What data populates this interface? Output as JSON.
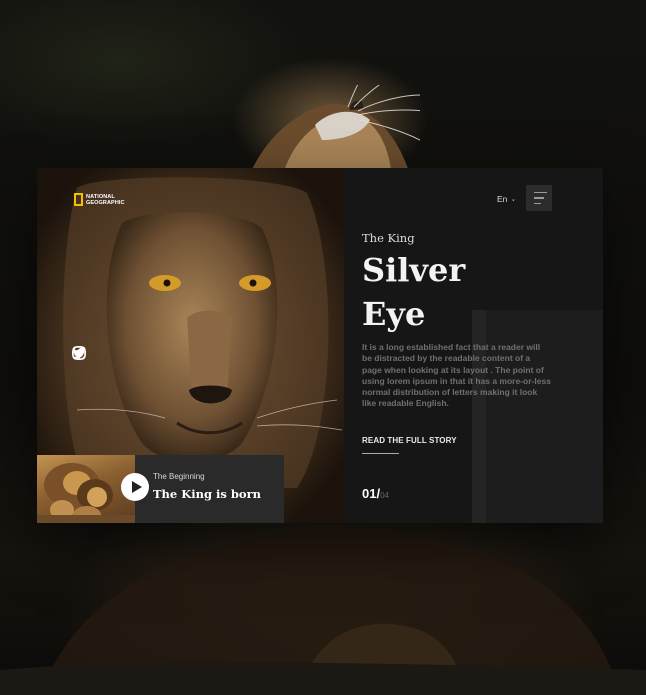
{
  "brand": {
    "logo_line1": "NATIONAL",
    "logo_line2": "GEOGRAPHIC",
    "accent": "#f2c200"
  },
  "header": {
    "language": "En",
    "menu_icon": "menu-icon"
  },
  "hero": {
    "eyebrow": "The King",
    "title_line1": "Silver",
    "title_line2": "Eye",
    "description": "It is a long established fact that a reader will be distracted by the readable content of a page when looking at its layout . The point of using lorem ipsum in that it has a more-or-less normal distribution of letters making it look like readable English.",
    "cta": "READ THE FULL STORY"
  },
  "pagination": {
    "current": "01/",
    "total": "04"
  },
  "social": [
    "facebook-icon",
    "instagram-icon",
    "twitter-icon"
  ],
  "story": {
    "subtitle": "The Beginning",
    "title": "The King is born"
  }
}
